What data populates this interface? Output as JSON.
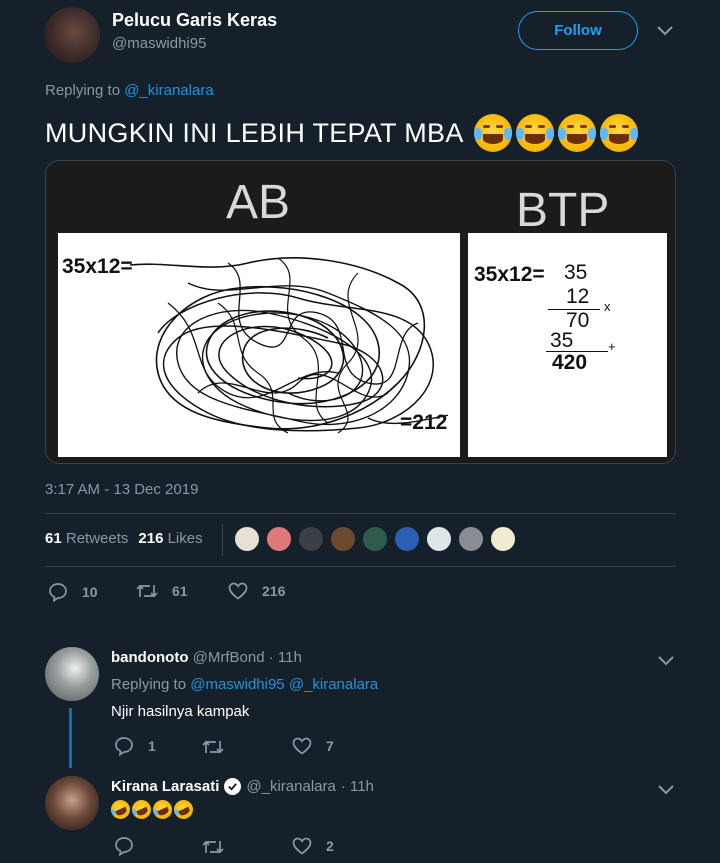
{
  "tweet": {
    "author_name": "Pelucu Garis Keras",
    "author_handle": "@maswidhi95",
    "follow_label": "Follow",
    "replying_prefix": "Replying to",
    "replying_to": "@_kiranalara",
    "text": "MUNGKIN INI LEBIH TEPAT MBA",
    "timestamp": "3:17 AM - 13 Dec 2019",
    "retweets_count": "61",
    "retweets_label": "Retweets",
    "likes_count": "216",
    "likes_label": "Likes",
    "actions": {
      "replies": "10",
      "retweets": "61",
      "likes": "216"
    }
  },
  "meme": {
    "left_title": "AB",
    "right_title": "BTP",
    "left_eq": "35x12=",
    "left_result": "=212",
    "right_eq": "35x12=",
    "m1": "35",
    "m2": "12",
    "times": "x",
    "p1": "70",
    "p2": "35",
    "plus": "+",
    "total": "420"
  },
  "replies": [
    {
      "name": "bandonoto",
      "handle": "@MrfBond",
      "time": "· 11h",
      "replying_prefix": "Replying to",
      "replying_to": "@maswidhi95 @_kiranalara",
      "text": "Njir hasilnya kampak",
      "replies": "1",
      "likes": "7"
    },
    {
      "name": "Kirana Larasati",
      "handle": "@_kiranalara",
      "time": "· 11h",
      "replies": "",
      "likes": "2"
    }
  ],
  "colors": {
    "bg": "#15202b",
    "accent": "#1da1f2",
    "muted": "#8899a6"
  }
}
